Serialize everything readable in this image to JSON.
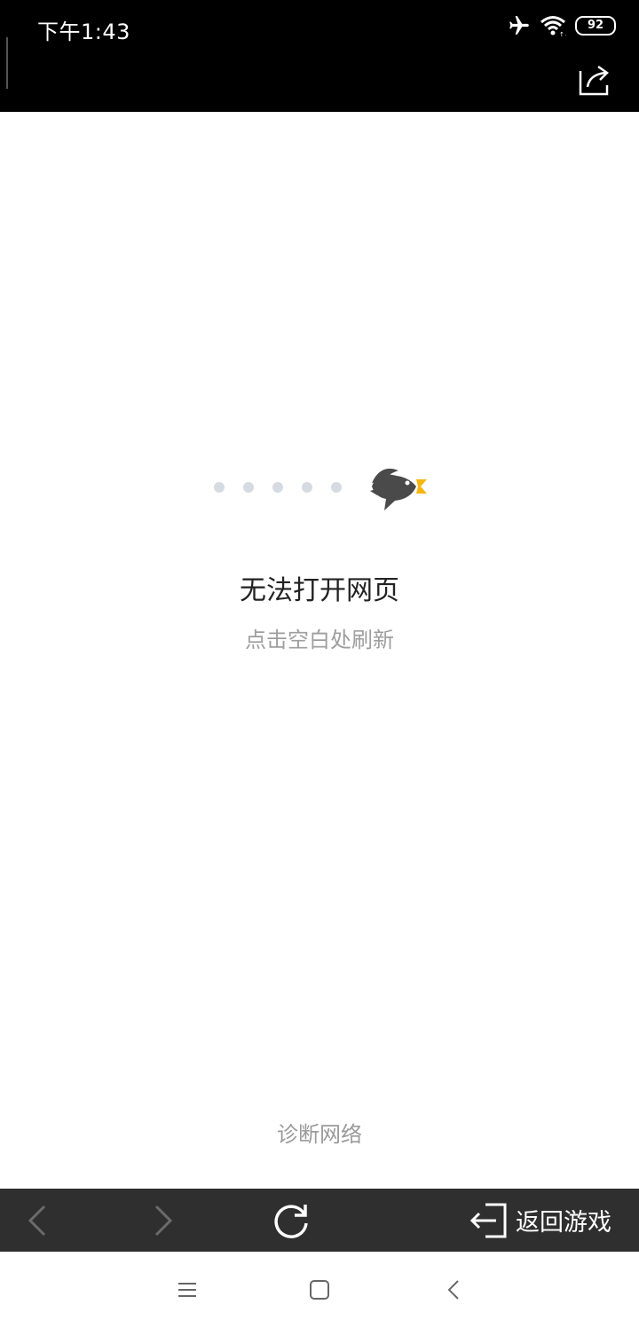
{
  "status_bar": {
    "time": "下午1:43",
    "battery": "92"
  },
  "error_page": {
    "title": "无法打开网页",
    "subtitle": "点击空白处刷新",
    "diagnose_link": "诊断网络"
  },
  "toolbar": {
    "return_label": "返回游戏"
  },
  "colors": {
    "toolbar_bg": "#2f2f2f",
    "bird": "#4a4a4a",
    "beak": "#f5b60f",
    "dots": "#d6dbe2"
  },
  "icons": [
    "airplane-icon",
    "wifi-icon",
    "battery-icon",
    "share-icon",
    "bird-icon",
    "back-icon",
    "forward-icon",
    "refresh-icon",
    "exit-icon",
    "menu-icon",
    "home-icon",
    "nav-back-icon"
  ]
}
